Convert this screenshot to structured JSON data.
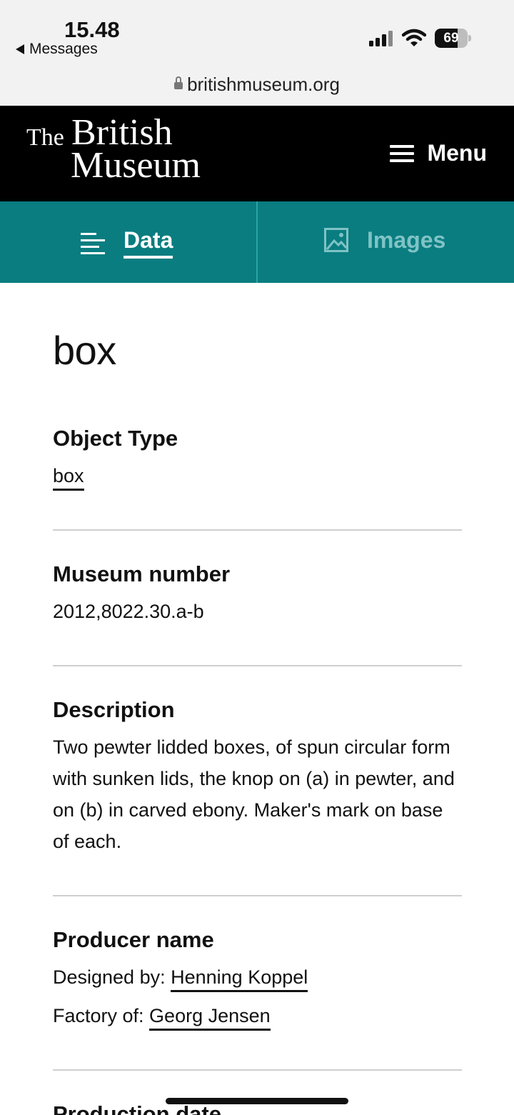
{
  "status": {
    "time": "15.48",
    "back_label": "Messages",
    "battery_level": "69"
  },
  "browser": {
    "url": "britishmuseum.org"
  },
  "site": {
    "logo_the": "The",
    "logo_british": "British",
    "logo_museum": "Museum",
    "menu_label": "Menu"
  },
  "tabs": [
    {
      "label": "Data",
      "active": true
    },
    {
      "label": "Images",
      "active": false
    }
  ],
  "object": {
    "title": "box",
    "object_type": {
      "heading": "Object Type",
      "value": "box"
    },
    "museum_number": {
      "heading": "Museum number",
      "value": "2012,8022.30.a-b"
    },
    "description": {
      "heading": "Description",
      "value": "Two pewter lidded boxes, of spun circular form with sunken lids, the knop on (a) in pewter, and on (b) in carved ebony. Maker's mark on base of each."
    },
    "producer": {
      "heading": "Producer name",
      "designed_prefix": "Designed by:",
      "designed_name": "Henning Koppel",
      "factory_prefix": "Factory of:",
      "factory_name": "Georg Jensen"
    },
    "next_heading": "Production date"
  },
  "icons": [
    "back-arrow-icon",
    "signal-icon",
    "wifi-icon",
    "battery-icon",
    "lock-icon",
    "hamburger-icon",
    "list-icon",
    "image-icon"
  ]
}
